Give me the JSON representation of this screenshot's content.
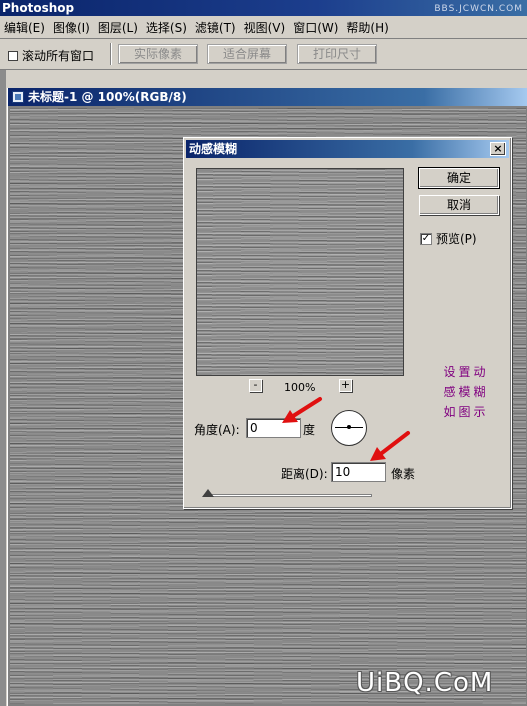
{
  "app": {
    "title": "Photoshop",
    "watermark_top": "BBS.JCWCN.COM",
    "watermark_bottom": "UiBQ.CoM"
  },
  "menubar": {
    "items": [
      "编辑(E)",
      "图像(I)",
      "图层(L)",
      "选择(S)",
      "滤镜(T)",
      "视图(V)",
      "窗口(W)",
      "帮助(H)"
    ]
  },
  "options_bar": {
    "scroll_all_windows": "滚动所有窗口",
    "actual_pixels": "实际像素",
    "fit_screen": "适合屏幕",
    "print_size": "打印尺寸"
  },
  "document": {
    "title": "未标题-1 @ 100%(RGB/8)"
  },
  "dialog": {
    "title": "动感模糊",
    "close": "×",
    "ok": "确定",
    "cancel": "取消",
    "preview_label": "预览(P)",
    "preview_checked": true,
    "check_mark": "✓",
    "zoom_out": "-",
    "zoom_in": "+",
    "zoom_level": "100%",
    "angle_label": "角度(A):",
    "angle_value": "0",
    "angle_unit": "度",
    "distance_label": "距离(D):",
    "distance_value": "10",
    "distance_unit": "像素",
    "slider_value": 10
  },
  "annotation": {
    "line1": "设置动",
    "line2": "感模糊",
    "line3": "如图示",
    "color": "#800080"
  },
  "colors": {
    "titlebar": "#0a246a",
    "dialog_bg": "#d4d0c8",
    "arrow": "#e01010"
  }
}
